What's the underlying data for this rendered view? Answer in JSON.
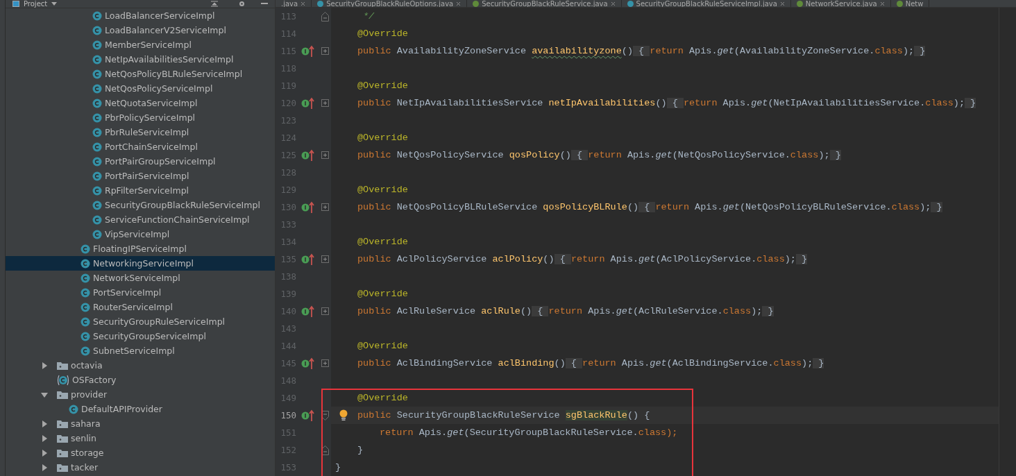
{
  "project_panel": {
    "title": "Project",
    "tree": [
      {
        "children": [
          {
            "children": [
              {
                "children": [
                  {
                    "label": "LoadBalancerServiceImpl",
                    "kind": "class",
                    "selected": false
                  },
                  {
                    "label": "LoadBalancerV2ServiceImpl",
                    "kind": "class",
                    "selected": false
                  },
                  {
                    "label": "MemberServiceImpl",
                    "kind": "class",
                    "selected": false
                  },
                  {
                    "label": "NetIpAvailabilitiesServiceImpl",
                    "kind": "class",
                    "selected": false
                  },
                  {
                    "label": "NetQosPolicyBLRuleServiceImpl",
                    "kind": "class",
                    "selected": false
                  },
                  {
                    "label": "NetQosPolicyServiceImpl",
                    "kind": "class",
                    "selected": false
                  },
                  {
                    "label": "NetQuotaServiceImpl",
                    "kind": "class",
                    "selected": false
                  },
                  {
                    "label": "PbrPolicyServiceImpl",
                    "kind": "class",
                    "selected": false
                  },
                  {
                    "label": "PbrRuleServiceImpl",
                    "kind": "class",
                    "selected": false
                  },
                  {
                    "label": "PortChainServiceImpl",
                    "kind": "class",
                    "selected": false
                  },
                  {
                    "label": "PortPairGroupServiceImpl",
                    "kind": "class",
                    "selected": false
                  },
                  {
                    "label": "PortPairServiceImpl",
                    "kind": "class",
                    "selected": false
                  },
                  {
                    "label": "RpFilterServiceImpl",
                    "kind": "class",
                    "selected": false
                  },
                  {
                    "label": "SecurityGroupBlackRuleServiceImpl",
                    "kind": "class",
                    "selected": false
                  },
                  {
                    "label": "ServiceFunctionChainServiceImpl",
                    "kind": "class",
                    "selected": false
                  },
                  {
                    "label": "VipServiceImpl",
                    "kind": "class",
                    "selected": false
                  }
                ]
              },
              {
                "label": "FloatingIPServiceImpl",
                "kind": "class",
                "selected": false
              },
              {
                "label": "NetworkingServiceImpl",
                "kind": "class",
                "selected": true
              },
              {
                "label": "NetworkServiceImpl",
                "kind": "class",
                "selected": false
              },
              {
                "label": "PortServiceImpl",
                "kind": "class",
                "selected": false
              },
              {
                "label": "RouterServiceImpl",
                "kind": "class",
                "selected": false
              },
              {
                "label": "SecurityGroupRuleServiceImpl",
                "kind": "class",
                "selected": false
              },
              {
                "label": "SecurityGroupServiceImpl",
                "kind": "class",
                "selected": false
              },
              {
                "label": "SubnetServiceImpl",
                "kind": "class",
                "selected": false
              }
            ]
          }
        ]
      },
      {
        "label": "octavia",
        "kind": "folder",
        "expanded": false,
        "selected": false
      },
      {
        "label": "OSFactory",
        "kind": "factory",
        "selected": false
      },
      {
        "label": "provider",
        "kind": "folder",
        "expanded": true,
        "selected": false,
        "children": [
          {
            "label": "DefaultAPIProvider",
            "kind": "class",
            "selected": false
          }
        ]
      },
      {
        "label": "sahara",
        "kind": "folder",
        "expanded": false,
        "selected": false
      },
      {
        "label": "senlin",
        "kind": "folder",
        "expanded": false,
        "selected": false
      },
      {
        "label": "storage",
        "kind": "folder",
        "expanded": false,
        "selected": false
      },
      {
        "label": "tacker",
        "kind": "folder",
        "expanded": false,
        "selected": false
      }
    ]
  },
  "editor_tabs": [
    {
      "label": ".java",
      "kind": "plain",
      "closable": true
    },
    {
      "label": "SecurityGroupBlackRuleOptions.java",
      "kind": "class",
      "closable": true
    },
    {
      "label": "SecurityGroupBlackRuleService.java",
      "kind": "interface",
      "closable": true
    },
    {
      "label": "SecurityGroupBlackRuleServiceImpl.java",
      "kind": "class",
      "closable": true
    },
    {
      "label": "NetworkService.java",
      "kind": "interface",
      "closable": true
    },
    {
      "label": "Netw",
      "kind": "interface",
      "closable": false
    }
  ],
  "editor": {
    "lines": [
      {
        "number": "113",
        "kind": "comment",
        "fold_end": true,
        "tokens": [
          {
            "text": "*/",
            "kind": "comment"
          }
        ]
      },
      {
        "number": "114",
        "kind": "member",
        "tokens": [
          {
            "text": "@Override",
            "kind": "annotation"
          }
        ]
      },
      {
        "number": "115",
        "kind": "member",
        "implements": true,
        "folded": true,
        "tokens": [
          {
            "text": "public",
            "kind": "keyword"
          },
          {
            "text": " AvailabilityZoneService ",
            "kind": "plain"
          },
          {
            "text": "availabilityzone",
            "kind": "method",
            "typo": true
          },
          {
            "text": "()",
            "kind": "plain"
          },
          {
            "text": " { ",
            "kind": "fold-brace"
          },
          {
            "text": "return",
            "kind": "keyword"
          },
          {
            "text": " Apis.",
            "kind": "plain"
          },
          {
            "text": "get",
            "kind": "static"
          },
          {
            "text": "(AvailabilityZoneService.",
            "kind": "plain"
          },
          {
            "text": "class",
            "kind": "keyword"
          },
          {
            "text": ");",
            "kind": "plain"
          },
          {
            "text": " }",
            "kind": "fold-brace"
          }
        ]
      },
      {
        "number": "118",
        "kind": "blank"
      },
      {
        "number": "119",
        "kind": "member",
        "tokens": [
          {
            "text": "@Override",
            "kind": "annotation"
          }
        ]
      },
      {
        "number": "120",
        "kind": "member",
        "implements": true,
        "folded": true,
        "tokens": [
          {
            "text": "public",
            "kind": "keyword"
          },
          {
            "text": " NetIpAvailabilitiesService ",
            "kind": "plain"
          },
          {
            "text": "netIpAvailabilities",
            "kind": "method"
          },
          {
            "text": "()",
            "kind": "plain"
          },
          {
            "text": " { ",
            "kind": "fold-brace"
          },
          {
            "text": "return",
            "kind": "keyword"
          },
          {
            "text": " Apis.",
            "kind": "plain"
          },
          {
            "text": "get",
            "kind": "static"
          },
          {
            "text": "(NetIpAvailabilitiesService.",
            "kind": "plain"
          },
          {
            "text": "class",
            "kind": "keyword"
          },
          {
            "text": ");",
            "kind": "plain"
          },
          {
            "text": " }",
            "kind": "fold-brace"
          }
        ]
      },
      {
        "number": "123",
        "kind": "blank"
      },
      {
        "number": "124",
        "kind": "member",
        "tokens": [
          {
            "text": "@Override",
            "kind": "annotation"
          }
        ]
      },
      {
        "number": "125",
        "kind": "member",
        "implements": true,
        "folded": true,
        "tokens": [
          {
            "text": "public",
            "kind": "keyword"
          },
          {
            "text": " NetQosPolicyService ",
            "kind": "plain"
          },
          {
            "text": "qosPolicy",
            "kind": "method"
          },
          {
            "text": "()",
            "kind": "plain"
          },
          {
            "text": " { ",
            "kind": "fold-brace"
          },
          {
            "text": "return",
            "kind": "keyword"
          },
          {
            "text": " Apis.",
            "kind": "plain"
          },
          {
            "text": "get",
            "kind": "static"
          },
          {
            "text": "(NetQosPolicyService.",
            "kind": "plain"
          },
          {
            "text": "class",
            "kind": "keyword"
          },
          {
            "text": ");",
            "kind": "plain"
          },
          {
            "text": " }",
            "kind": "fold-brace"
          }
        ]
      },
      {
        "number": "128",
        "kind": "blank"
      },
      {
        "number": "129",
        "kind": "member",
        "tokens": [
          {
            "text": "@Override",
            "kind": "annotation"
          }
        ]
      },
      {
        "number": "130",
        "kind": "member",
        "implements": true,
        "folded": true,
        "tokens": [
          {
            "text": "public",
            "kind": "keyword"
          },
          {
            "text": " NetQosPolicyBLRuleService ",
            "kind": "plain"
          },
          {
            "text": "qosPolicyBLRule",
            "kind": "method"
          },
          {
            "text": "()",
            "kind": "plain"
          },
          {
            "text": " { ",
            "kind": "fold-brace"
          },
          {
            "text": "return",
            "kind": "keyword"
          },
          {
            "text": " Apis.",
            "kind": "plain"
          },
          {
            "text": "get",
            "kind": "static"
          },
          {
            "text": "(NetQosPolicyBLRuleService.",
            "kind": "plain"
          },
          {
            "text": "class",
            "kind": "keyword"
          },
          {
            "text": ");",
            "kind": "plain"
          },
          {
            "text": " }",
            "kind": "fold-brace"
          }
        ]
      },
      {
        "number": "133",
        "kind": "blank"
      },
      {
        "number": "134",
        "kind": "member",
        "tokens": [
          {
            "text": "@Override",
            "kind": "annotation"
          }
        ]
      },
      {
        "number": "135",
        "kind": "member",
        "implements": true,
        "folded": true,
        "tokens": [
          {
            "text": "public",
            "kind": "keyword"
          },
          {
            "text": " AclPolicyService ",
            "kind": "plain"
          },
          {
            "text": "aclPolicy",
            "kind": "method"
          },
          {
            "text": "()",
            "kind": "plain"
          },
          {
            "text": " { ",
            "kind": "fold-brace"
          },
          {
            "text": "return",
            "kind": "keyword"
          },
          {
            "text": " Apis.",
            "kind": "plain"
          },
          {
            "text": "get",
            "kind": "static"
          },
          {
            "text": "(AclPolicyService.",
            "kind": "plain"
          },
          {
            "text": "class",
            "kind": "keyword"
          },
          {
            "text": ");",
            "kind": "plain"
          },
          {
            "text": " }",
            "kind": "fold-brace"
          }
        ]
      },
      {
        "number": "138",
        "kind": "blank"
      },
      {
        "number": "139",
        "kind": "member",
        "tokens": [
          {
            "text": "@Override",
            "kind": "annotation"
          }
        ]
      },
      {
        "number": "140",
        "kind": "member",
        "implements": true,
        "folded": true,
        "tokens": [
          {
            "text": "public",
            "kind": "keyword"
          },
          {
            "text": " AclRuleService ",
            "kind": "plain"
          },
          {
            "text": "aclRule",
            "kind": "method"
          },
          {
            "text": "()",
            "kind": "plain"
          },
          {
            "text": " { ",
            "kind": "fold-brace"
          },
          {
            "text": "return",
            "kind": "keyword"
          },
          {
            "text": " Apis.",
            "kind": "plain"
          },
          {
            "text": "get",
            "kind": "static"
          },
          {
            "text": "(AclRuleService.",
            "kind": "plain"
          },
          {
            "text": "class",
            "kind": "keyword"
          },
          {
            "text": ");",
            "kind": "plain"
          },
          {
            "text": " }",
            "kind": "fold-brace"
          }
        ]
      },
      {
        "number": "143",
        "kind": "blank"
      },
      {
        "number": "144",
        "kind": "member",
        "tokens": [
          {
            "text": "@Override",
            "kind": "annotation"
          }
        ]
      },
      {
        "number": "145",
        "kind": "member",
        "implements": true,
        "folded": true,
        "tokens": [
          {
            "text": "public",
            "kind": "keyword"
          },
          {
            "text": " AclBindingService ",
            "kind": "plain"
          },
          {
            "text": "aclBinding",
            "kind": "method"
          },
          {
            "text": "()",
            "kind": "plain"
          },
          {
            "text": " { ",
            "kind": "fold-brace"
          },
          {
            "text": "return",
            "kind": "keyword"
          },
          {
            "text": " Apis.",
            "kind": "plain"
          },
          {
            "text": "get",
            "kind": "static"
          },
          {
            "text": "(AclBindingService.",
            "kind": "plain"
          },
          {
            "text": "class",
            "kind": "keyword"
          },
          {
            "text": ");",
            "kind": "plain"
          },
          {
            "text": " }",
            "kind": "fold-brace"
          }
        ]
      },
      {
        "number": "148",
        "kind": "blank"
      },
      {
        "number": "149",
        "kind": "member",
        "boxed": true,
        "tokens": [
          {
            "text": "@Override",
            "kind": "annotation"
          }
        ]
      },
      {
        "number": "150",
        "kind": "member",
        "boxed": true,
        "current": true,
        "implements": true,
        "folded": false,
        "bulb": true,
        "tokens": [
          {
            "text": "public",
            "kind": "keyword"
          },
          {
            "text": " SecurityGroupBlackRuleService ",
            "kind": "plain"
          },
          {
            "text": "sgBlackRule",
            "kind": "method-highlight"
          },
          {
            "text": "() {",
            "kind": "plain"
          }
        ]
      },
      {
        "number": "151",
        "kind": "body",
        "boxed": true,
        "tokens": [
          {
            "text": "return",
            "kind": "keyword"
          },
          {
            "text": " Apis.",
            "kind": "plain"
          },
          {
            "text": "get",
            "kind": "static"
          },
          {
            "text": "(SecurityGroupBlackRuleService.",
            "kind": "plain"
          },
          {
            "text": "class",
            "kind": "keyword"
          },
          {
            "text": ");",
            "kind": "keyword"
          }
        ]
      },
      {
        "number": "152",
        "kind": "member",
        "boxed": true,
        "fold_end": true,
        "tokens": [
          {
            "text": "}",
            "kind": "plain"
          }
        ]
      },
      {
        "number": "153",
        "kind": "class-end",
        "boxed": true,
        "tokens": [
          {
            "text": "}",
            "kind": "plain"
          }
        ]
      }
    ]
  }
}
